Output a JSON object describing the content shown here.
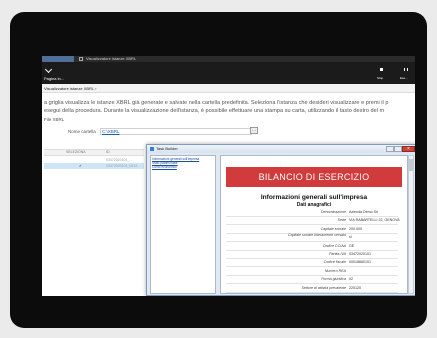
{
  "taskbar": {
    "title": "Visualizzatore istanze XBRL"
  },
  "header": {
    "back_label": "Pagina in...",
    "actions": [
      {
        "label": "Stop",
        "icon": "stop-icon"
      },
      {
        "label": "Ese...",
        "icon": "pause-icon"
      }
    ]
  },
  "breadcrumb": {
    "text": "Visualizzatore istanze XBRL ›"
  },
  "description": {
    "line1": "a griglia visualizza le istanze XBRL già generate e salvate nella cartella predefinita. Seleziona l'istanza che desideri visualizzare e premi il p",
    "line2": "esegui della procedura. Durante la visualizzazione dell'istanza, è possibile effettuare una stampa su carta, utilizzando il tasto destro del m"
  },
  "section_title": "File XBRL",
  "folder": {
    "label": "Nome cartella",
    "value": "C:\\XBRL",
    "browse_icon": "folder-browse-icon"
  },
  "grid": {
    "columns": [
      "SELEZIONA",
      "ID"
    ],
    "rows": [
      {
        "selected": "",
        "id": "03472020101_..."
      },
      {
        "selected": "✔",
        "id": "03472020101_0012..."
      }
    ],
    "highlight_color": "#cde6f7"
  },
  "dialog": {
    "title": "Task Builder",
    "nav": [
      "Informazioni generali sull'impresa",
      "Stato patrimoniale",
      "Conto economico"
    ],
    "banner": "BILANCIO DI ESERCIZIO",
    "doc_title": "Informazioni generali sull'impresa",
    "doc_subtitle": "Dati anagrafici",
    "fields": [
      {
        "label": "Denominazione",
        "value": "Azienda Demo Srl"
      },
      {
        "label": "Sede",
        "value": "VIA RABARTELLI 22, GENOVA"
      },
      {
        "label": "Capitale sociale",
        "value": "200.000"
      },
      {
        "label": "Capitale sociale interamente versato",
        "value": "si"
      },
      {
        "label": "Codice CCIAA",
        "value": "GE"
      },
      {
        "label": "Partita IVA",
        "value": "03472020101"
      },
      {
        "label": "Codice fiscale",
        "value": "00018660101"
      },
      {
        "label": "Numero REA",
        "value": ""
      },
      {
        "label": "Forma giuridica",
        "value": "02"
      },
      {
        "label": "Settore di attività prevalente",
        "value": "220120"
      }
    ],
    "banner_color": "#d13b3b"
  }
}
